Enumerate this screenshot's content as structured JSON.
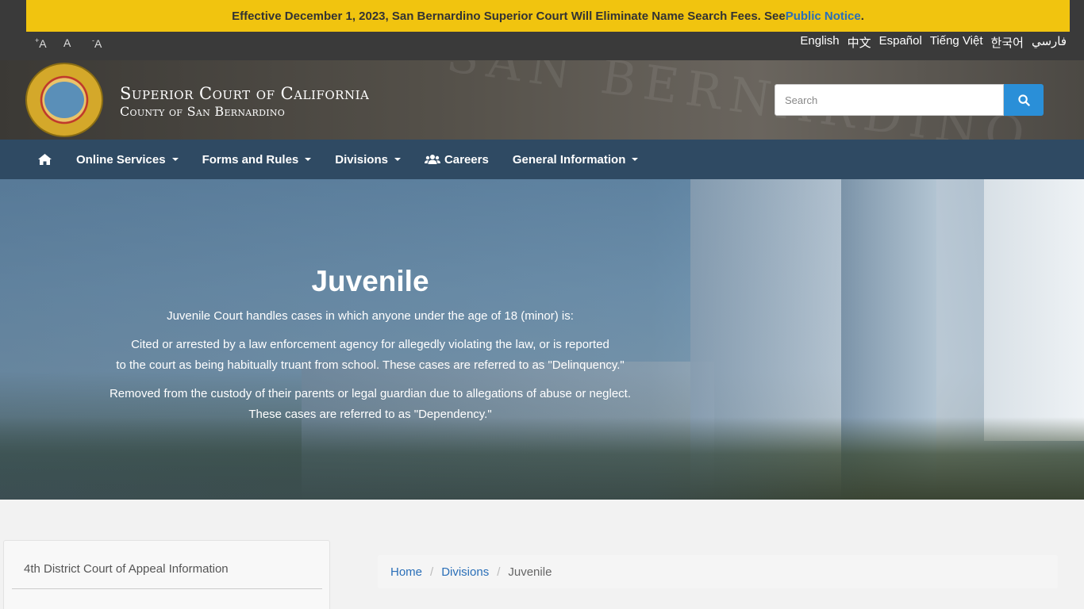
{
  "alert": {
    "text": "Effective December 1, 2023, San Bernardino Superior Court Will Eliminate Name Search Fees. See ",
    "link": "Public Notice",
    "end": "."
  },
  "font_sizes": {
    "increase": "A",
    "increase_mark": "+",
    "normal": "A",
    "decrease": "A",
    "decrease_mark": "-"
  },
  "languages": [
    "English",
    "中文",
    "Español",
    "Tiếng Việt",
    "한국어",
    "فارسي"
  ],
  "header": {
    "title": "Superior Court of California",
    "subtitle": "County of San Bernardino",
    "search_placeholder": "Search"
  },
  "nav": {
    "items": [
      {
        "label": "Online Services",
        "dropdown": true
      },
      {
        "label": "Forms and Rules",
        "dropdown": true
      },
      {
        "label": "Divisions",
        "dropdown": true
      },
      {
        "label": "Careers",
        "dropdown": false,
        "icon": "users-icon"
      },
      {
        "label": "General Information",
        "dropdown": true
      }
    ]
  },
  "hero": {
    "title": "Juvenile",
    "intro": "Juvenile Court handles cases in which anyone under the age of 18 (minor) is:",
    "p1_line1": "Cited or arrested by a law enforcement agency for allegedly violating the law, or is reported",
    "p1_line2": "to the court as being habitually truant from school. These cases are referred to as \"Delinquency.\"",
    "p2_line1": "Removed from the custody of their parents or legal guardian due to allegations of abuse or neglect.",
    "p2_line2": "These cases are referred to as \"Dependency.\""
  },
  "sidebar": {
    "first_link": "4th District Court of Appeal Information"
  },
  "breadcrumb": {
    "home": "Home",
    "divisions": "Divisions",
    "current": "Juvenile"
  },
  "colors": {
    "alert_bg": "#f1c40f",
    "nav_bg": "#2f4a63",
    "search_button": "#2a8fd8",
    "link": "#2a6fb8"
  }
}
